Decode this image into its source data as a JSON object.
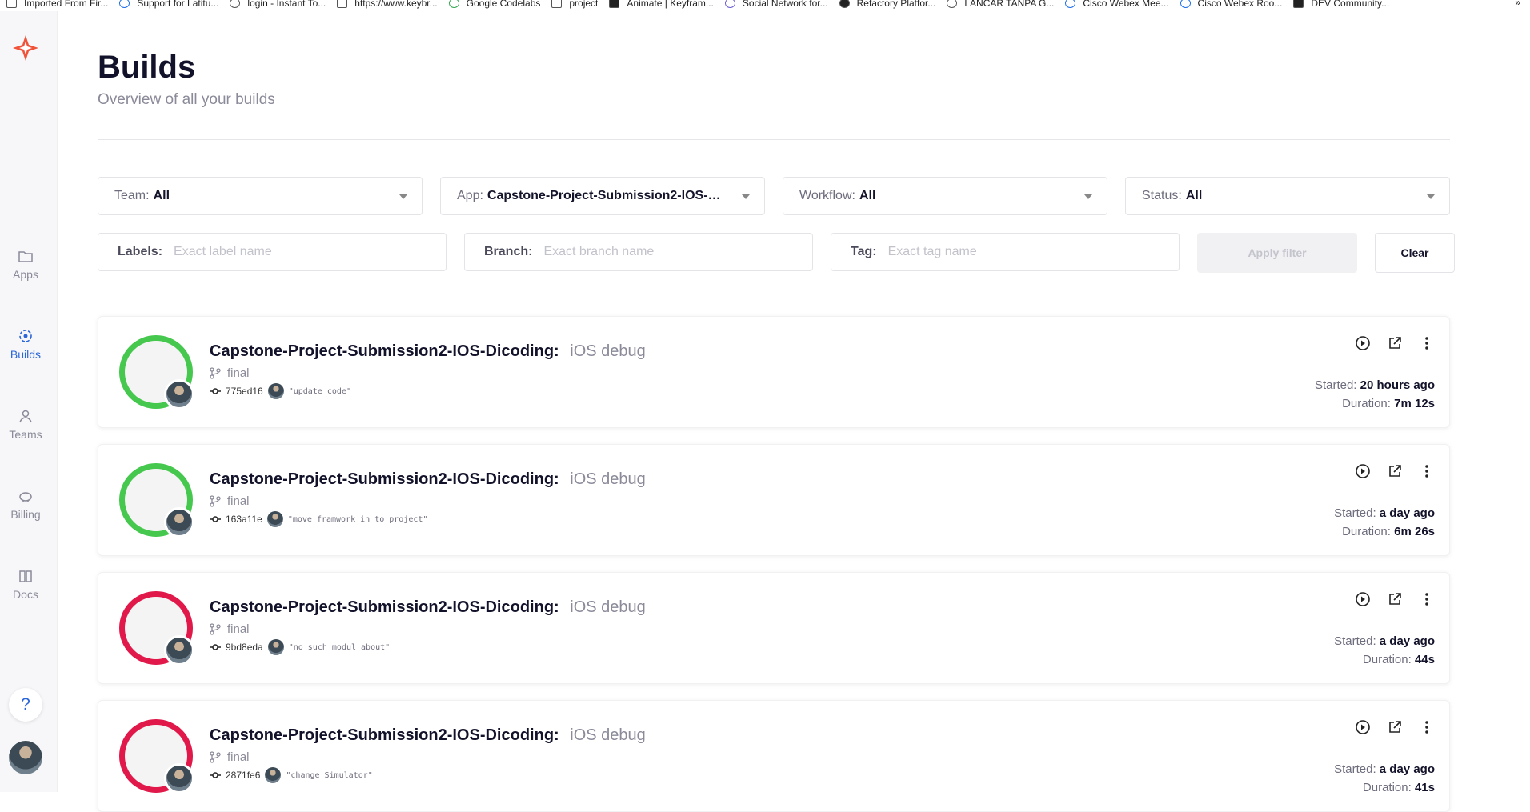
{
  "bookmarks": [
    {
      "label": "Imported From Fir...",
      "icon": "folder-icon"
    },
    {
      "label": "Support for Latitu...",
      "icon": "dell-icon"
    },
    {
      "label": "login - Instant To...",
      "icon": "globe-icon"
    },
    {
      "label": "https://www.keybr...",
      "icon": "page-icon"
    },
    {
      "label": "Google Codelabs",
      "icon": "codelabs-icon"
    },
    {
      "label": "project",
      "icon": "folder-icon"
    },
    {
      "label": "Animate | Keyfram...",
      "icon": "animate-icon"
    },
    {
      "label": "Social Network for...",
      "icon": "social-icon"
    },
    {
      "label": "Refactory Platfor...",
      "icon": "refactory-icon"
    },
    {
      "label": "LANCAR TANPA G...",
      "icon": "globe-icon"
    },
    {
      "label": "Cisco Webex Mee...",
      "icon": "webex-icon"
    },
    {
      "label": "Cisco Webex Roo...",
      "icon": "webex-icon"
    },
    {
      "label": "DEV Community...",
      "icon": "dev-icon"
    }
  ],
  "bookmarks_more": "»",
  "sidebar": {
    "items": [
      {
        "label": "Apps",
        "icon": "folder-icon",
        "active": false
      },
      {
        "label": "Builds",
        "icon": "builds-icon",
        "active": true
      },
      {
        "label": "Teams",
        "icon": "person-icon",
        "active": false
      },
      {
        "label": "Billing",
        "icon": "piggy-bank-icon",
        "active": false
      },
      {
        "label": "Docs",
        "icon": "book-icon",
        "active": false
      }
    ],
    "help": "?"
  },
  "header": {
    "title": "Builds",
    "subtitle": "Overview of all your builds"
  },
  "filters": {
    "team": {
      "label": "Team:",
      "value": "All"
    },
    "app": {
      "label": "App:",
      "value": "Capstone-Project-Submission2-IOS-Dic..."
    },
    "workflow": {
      "label": "Workflow:",
      "value": "All"
    },
    "status": {
      "label": "Status:",
      "value": "All"
    },
    "labels": {
      "label": "Labels:",
      "placeholder": "Exact label name",
      "value": ""
    },
    "branch": {
      "label": "Branch:",
      "placeholder": "Exact branch name",
      "value": ""
    },
    "tag": {
      "label": "Tag:",
      "placeholder": "Exact tag name",
      "value": ""
    },
    "apply_label": "Apply filter",
    "clear_label": "Clear"
  },
  "builds": [
    {
      "app": "Capstone-Project-Submission2-IOS-Dicoding:",
      "workflow": "iOS debug",
      "branch": "final",
      "commit": "775ed16",
      "message": "\"update code\"",
      "status": "success",
      "started_label": "Started:",
      "started": "20 hours ago",
      "duration_label": "Duration:",
      "duration": "7m 12s"
    },
    {
      "app": "Capstone-Project-Submission2-IOS-Dicoding:",
      "workflow": "iOS debug",
      "branch": "final",
      "commit": "163a11e",
      "message": "\"move framwork in to project\"",
      "status": "success",
      "started_label": "Started:",
      "started": "a day ago",
      "duration_label": "Duration:",
      "duration": "6m 26s"
    },
    {
      "app": "Capstone-Project-Submission2-IOS-Dicoding:",
      "workflow": "iOS debug",
      "branch": "final",
      "commit": "9bd8eda",
      "message": "\"no such modul about\"",
      "status": "failed",
      "started_label": "Started:",
      "started": "a day ago",
      "duration_label": "Duration:",
      "duration": "44s"
    },
    {
      "app": "Capstone-Project-Submission2-IOS-Dicoding:",
      "workflow": "iOS debug",
      "branch": "final",
      "commit": "2871fe6",
      "message": "\"change Simulator\"",
      "status": "failed",
      "started_label": "Started:",
      "started": "a day ago",
      "duration_label": "Duration:",
      "duration": "41s"
    }
  ],
  "colors": {
    "success": "#46c84e",
    "failed": "#e0194a",
    "accent": "#2b66d9"
  }
}
